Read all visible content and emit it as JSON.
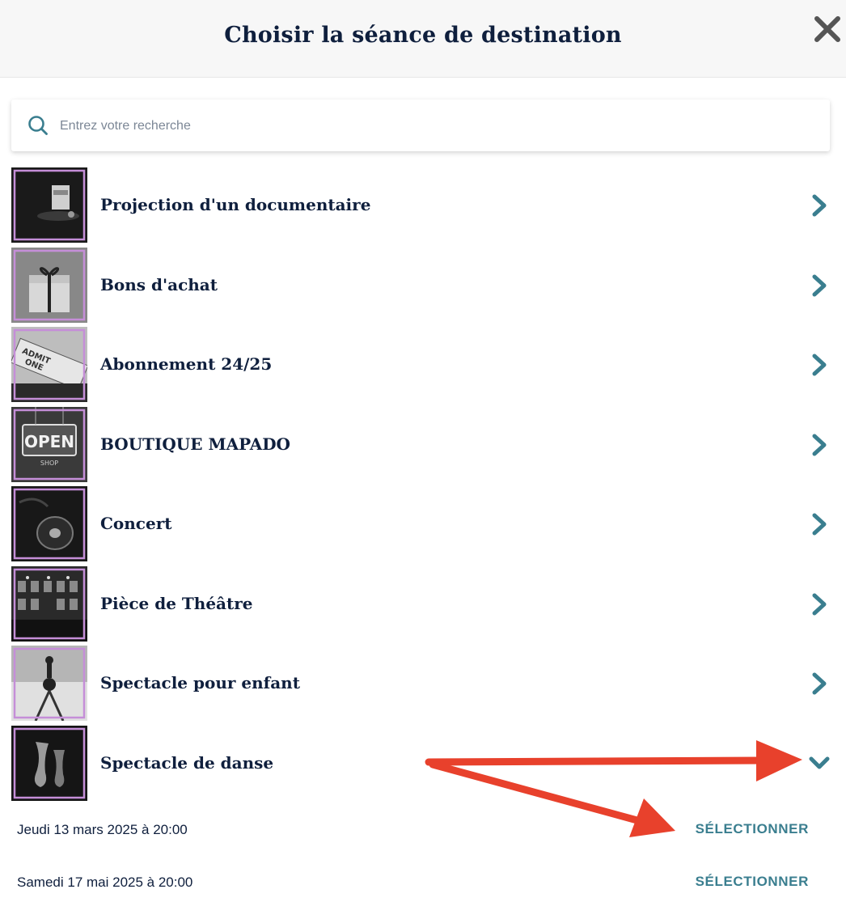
{
  "header": {
    "title": "Choisir la séance de destination",
    "close_icon": "close-icon"
  },
  "search": {
    "placeholder": "Entrez votre recherche",
    "value": "",
    "icon": "search-icon"
  },
  "events": [
    {
      "label": "Projection d'un documentaire",
      "thumb": "popcorn-photo",
      "state": "collapsed"
    },
    {
      "label": "Bons d'achat",
      "thumb": "gift-box-photo",
      "state": "collapsed"
    },
    {
      "label": "Abonnement 24/25",
      "thumb": "admit-one-ticket-photo",
      "state": "collapsed"
    },
    {
      "label": "BOUTIQUE MAPADO",
      "thumb": "open-shop-sign-photo",
      "state": "collapsed"
    },
    {
      "label": "Concert",
      "thumb": "vinyl-record-photo",
      "state": "collapsed"
    },
    {
      "label": "Pièce de Théâtre",
      "thumb": "theatre-hall-photo",
      "state": "collapsed"
    },
    {
      "label": "Spectacle pour enfant",
      "thumb": "acrobat-photo",
      "state": "collapsed"
    },
    {
      "label": "Spectacle de danse",
      "thumb": "ballet-shoes-photo",
      "state": "expanded"
    }
  ],
  "sessions": [
    {
      "date": "Jeudi 13 mars 2025 à 20:00",
      "action": "SÉLECTIONNER"
    },
    {
      "date": "Samedi 17 mai 2025 à 20:00",
      "action": "SÉLECTIONNER"
    }
  ],
  "colors": {
    "accent": "#3a7e8f",
    "text": "#0f1f3d",
    "annotation_arrow": "#e8412c",
    "thumb_border": "#c58ed8"
  }
}
